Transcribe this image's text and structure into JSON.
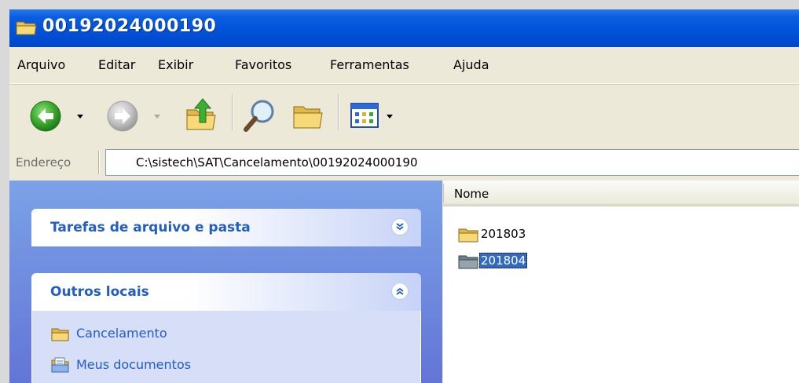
{
  "window": {
    "title": "00192024000190"
  },
  "menu": {
    "items": [
      {
        "label": "Arquivo"
      },
      {
        "label": "Editar"
      },
      {
        "label": "Exibir"
      },
      {
        "label": "Favoritos"
      },
      {
        "label": "Ferramentas"
      },
      {
        "label": "Ajuda"
      }
    ]
  },
  "toolbar": {
    "buttons": [
      {
        "icon": "back-icon"
      },
      {
        "icon": "forward-icon"
      },
      {
        "icon": "up-folder-icon"
      },
      {
        "icon": "search-icon"
      },
      {
        "icon": "folders-icon"
      },
      {
        "icon": "views-icon"
      }
    ]
  },
  "address": {
    "label": "Endereço",
    "value": "C:\\sistech\\SAT\\Cancelamento\\00192024000190"
  },
  "taskpane": {
    "groups": [
      {
        "title": "Tarefas de arquivo e pasta",
        "state": "collapsed",
        "links": []
      },
      {
        "title": "Outros locais",
        "state": "expanded",
        "links": [
          {
            "label": "Cancelamento",
            "icon": "folder-icon"
          },
          {
            "label": "Meus documentos",
            "icon": "my-documents-icon"
          }
        ]
      }
    ]
  },
  "list": {
    "columns": [
      {
        "label": "Nome"
      }
    ],
    "items": [
      {
        "name": "201803",
        "type": "folder",
        "selected": false
      },
      {
        "name": "201804",
        "type": "folder",
        "selected": true
      }
    ]
  },
  "colors": {
    "titlebar": "#0153d9",
    "taskpane_link": "#215dc6",
    "selection": "#316ac5"
  }
}
